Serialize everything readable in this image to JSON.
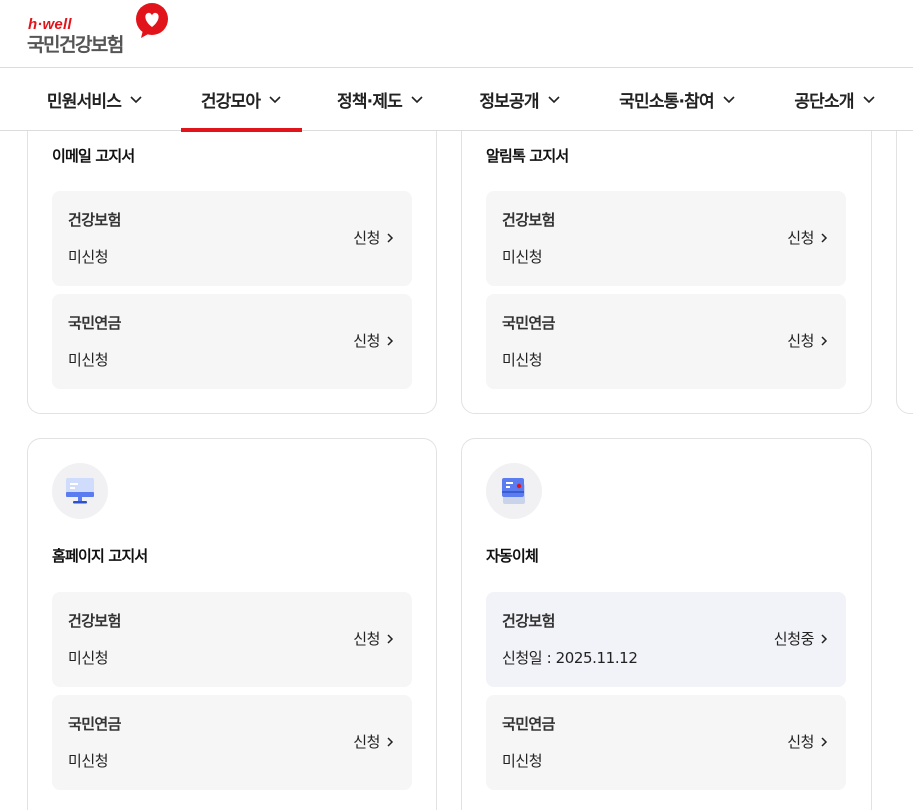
{
  "header": {
    "logo_small": "h·well",
    "logo_main": "국민건강보험"
  },
  "nav": {
    "items": [
      {
        "label": "민원서비스"
      },
      {
        "label": "건강모아"
      },
      {
        "label": "정책·제도"
      },
      {
        "label": "정보공개"
      },
      {
        "label": "국민소통·참여"
      },
      {
        "label": "공단소개"
      }
    ],
    "active_index": 1
  },
  "cards": {
    "email": {
      "title": "이메일 고지서",
      "rows": [
        {
          "name": "건강보험",
          "status": "미신청",
          "action": "신청"
        },
        {
          "name": "국민연금",
          "status": "미신청",
          "action": "신청"
        }
      ]
    },
    "alimtalk": {
      "title": "알림톡 고지서",
      "rows": [
        {
          "name": "건강보험",
          "status": "미신청",
          "action": "신청"
        },
        {
          "name": "국민연금",
          "status": "미신청",
          "action": "신청"
        }
      ]
    },
    "homepage": {
      "title": "홈페이지 고지서",
      "icon": "monitor-icon",
      "rows": [
        {
          "name": "건강보험",
          "status": "미신청",
          "action": "신청"
        },
        {
          "name": "국민연금",
          "status": "미신청",
          "action": "신청"
        }
      ]
    },
    "autopay": {
      "title": "자동이체",
      "icon": "card-icon",
      "rows": [
        {
          "name": "건강보험",
          "status": "신청일 : 2025.11.12",
          "action": "신청중"
        },
        {
          "name": "국민연금",
          "status": "미신청",
          "action": "신청"
        }
      ]
    }
  },
  "colors": {
    "brand_red": "#e2141b",
    "row_bg": "#f6f6f6",
    "row_applied_bg": "#f2f3f8",
    "icon_blue": "#5b7cf0"
  }
}
